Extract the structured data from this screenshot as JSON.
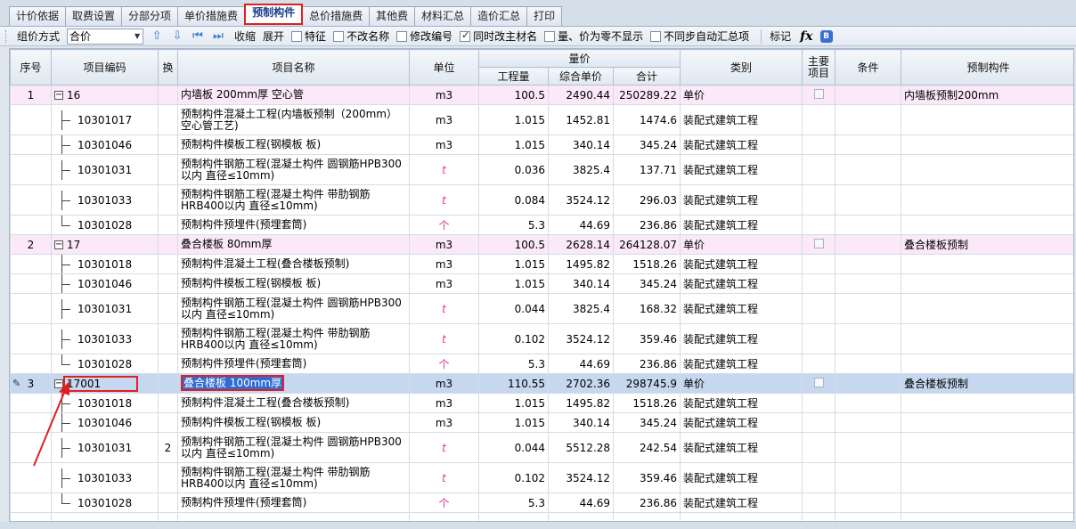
{
  "tabs": [
    "计价依据",
    "取费设置",
    "分部分项",
    "单价措施费",
    "预制构件",
    "总价措施费",
    "其他费",
    "材料汇总",
    "造价汇总",
    "打印"
  ],
  "active_tab_index": 4,
  "toolbar": {
    "group_label": "组价方式",
    "group_value": "合价",
    "collapse": "收缩",
    "expand": "展开",
    "checks": [
      {
        "label": "特征",
        "checked": false
      },
      {
        "label": "不改名称",
        "checked": false
      },
      {
        "label": "修改编号",
        "checked": false
      },
      {
        "label": "同时改主材名",
        "checked": true
      },
      {
        "label": "量、价为零不显示",
        "checked": false
      },
      {
        "label": "不同步自动汇总项",
        "checked": false
      }
    ],
    "mark": "标记",
    "fx": "fx"
  },
  "headers": {
    "seq": "序号",
    "code": "项目编码",
    "swap": "换",
    "name": "项目名称",
    "unit": "单位",
    "qty_price": "量价",
    "qty": "工程量",
    "unit_price": "综合单价",
    "total": "合计",
    "category": "类别",
    "main": "主要\n项目",
    "condition": "条件",
    "component": "预制构件"
  },
  "rows": [
    {
      "type": "group",
      "seq": "1",
      "code": "16",
      "swap": "",
      "name": "内墙板 200mm厚 空心管",
      "unit": "m3",
      "qty": "100.5",
      "price": "2490.44",
      "total": "250289.22",
      "cat": "单价",
      "comp": "内墙板预制200mm"
    },
    {
      "type": "child",
      "code": "10301017",
      "swap": "",
      "name": "预制构件混凝土工程(内墙板预制（200mm）空心管工艺)",
      "unit": "m3",
      "qty": "1.015",
      "price": "1452.81",
      "total": "1474.6",
      "cat": "装配式建筑工程"
    },
    {
      "type": "child",
      "code": "10301046",
      "swap": "",
      "name": "预制构件模板工程(钢模板 板)",
      "unit": "m3",
      "qty": "1.015",
      "price": "340.14",
      "total": "345.24",
      "cat": "装配式建筑工程"
    },
    {
      "type": "child",
      "code": "10301031",
      "swap": "",
      "name": "预制构件钢筋工程(混凝土构件 圆钢筋HPB300以内 直径≤10mm)",
      "unit": "t",
      "qty": "0.036",
      "price": "3825.4",
      "total": "137.71",
      "cat": "装配式建筑工程"
    },
    {
      "type": "child",
      "code": "10301033",
      "swap": "",
      "name": "预制构件钢筋工程(混凝土构件 带肋钢筋HRB400以内 直径≤10mm)",
      "unit": "t",
      "qty": "0.084",
      "price": "3524.12",
      "total": "296.03",
      "cat": "装配式建筑工程"
    },
    {
      "type": "child",
      "last": true,
      "code": "10301028",
      "swap": "",
      "name": "预制构件预埋件(预埋套筒)",
      "unit": "个",
      "qty": "5.3",
      "price": "44.69",
      "total": "236.86",
      "cat": "装配式建筑工程"
    },
    {
      "type": "group",
      "seq": "2",
      "code": "17",
      "swap": "",
      "name": "叠合楼板 80mm厚",
      "unit": "m3",
      "qty": "100.5",
      "price": "2628.14",
      "total": "264128.07",
      "cat": "单价",
      "comp": "叠合楼板预制"
    },
    {
      "type": "child",
      "code": "10301018",
      "swap": "",
      "name": "预制构件混凝土工程(叠合楼板预制)",
      "unit": "m3",
      "qty": "1.015",
      "price": "1495.82",
      "total": "1518.26",
      "cat": "装配式建筑工程"
    },
    {
      "type": "child",
      "code": "10301046",
      "swap": "",
      "name": "预制构件模板工程(钢模板 板)",
      "unit": "m3",
      "qty": "1.015",
      "price": "340.14",
      "total": "345.24",
      "cat": "装配式建筑工程"
    },
    {
      "type": "child",
      "code": "10301031",
      "swap": "",
      "name": "预制构件钢筋工程(混凝土构件 圆钢筋HPB300以内 直径≤10mm)",
      "unit": "t",
      "qty": "0.044",
      "price": "3825.4",
      "total": "168.32",
      "cat": "装配式建筑工程"
    },
    {
      "type": "child",
      "code": "10301033",
      "swap": "",
      "name": "预制构件钢筋工程(混凝土构件 带肋钢筋HRB400以内 直径≤10mm)",
      "unit": "t",
      "qty": "0.102",
      "price": "3524.12",
      "total": "359.46",
      "cat": "装配式建筑工程"
    },
    {
      "type": "child",
      "last": true,
      "code": "10301028",
      "swap": "",
      "name": "预制构件预埋件(预埋套筒)",
      "unit": "个",
      "qty": "5.3",
      "price": "44.69",
      "total": "236.86",
      "cat": "装配式建筑工程"
    },
    {
      "type": "sel",
      "seq": "3",
      "code": "17001",
      "swap": "",
      "name": "叠合楼板 100mm厚",
      "unit": "m3",
      "qty": "110.55",
      "price": "2702.36",
      "total": "298745.9",
      "cat": "单价",
      "comp": "叠合楼板预制"
    },
    {
      "type": "child",
      "code": "10301018",
      "swap": "",
      "name": "预制构件混凝土工程(叠合楼板预制)",
      "unit": "m3",
      "qty": "1.015",
      "price": "1495.82",
      "total": "1518.26",
      "cat": "装配式建筑工程"
    },
    {
      "type": "child",
      "code": "10301046",
      "swap": "",
      "name": "预制构件模板工程(钢模板 板)",
      "unit": "m3",
      "qty": "1.015",
      "price": "340.14",
      "total": "345.24",
      "cat": "装配式建筑工程"
    },
    {
      "type": "child",
      "code": "10301031",
      "swap": "2",
      "name": "预制构件钢筋工程(混凝土构件 圆钢筋HPB300以内 直径≤10mm)",
      "unit": "t",
      "qty": "0.044",
      "price": "5512.28",
      "total": "242.54",
      "cat": "装配式建筑工程"
    },
    {
      "type": "child",
      "code": "10301033",
      "swap": "",
      "name": "预制构件钢筋工程(混凝土构件 带肋钢筋HRB400以内 直径≤10mm)",
      "unit": "t",
      "qty": "0.102",
      "price": "3524.12",
      "total": "359.46",
      "cat": "装配式建筑工程"
    },
    {
      "type": "child",
      "last": true,
      "code": "10301028",
      "swap": "",
      "name": "预制构件预埋件(预埋套筒)",
      "unit": "个",
      "qty": "5.3",
      "price": "44.69",
      "total": "236.86",
      "cat": "装配式建筑工程"
    }
  ],
  "colors": {
    "group_row": "#fbe9f9",
    "selected_row": "#c5d8ef",
    "highlight": "#e02020",
    "accent": "#2e6bd3"
  }
}
